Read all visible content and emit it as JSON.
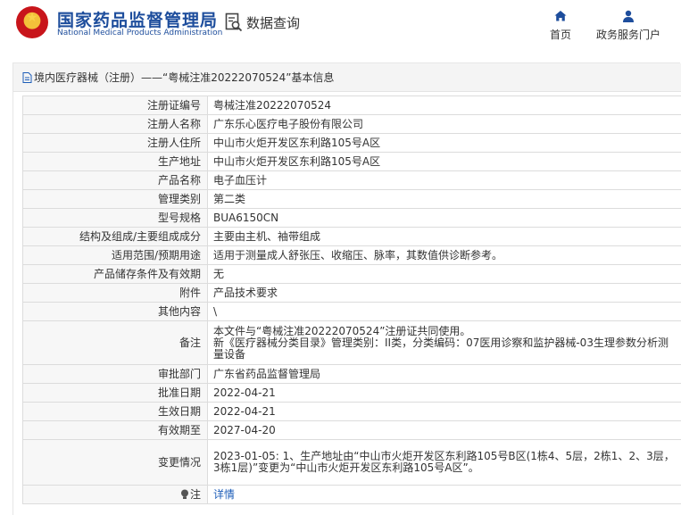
{
  "header": {
    "site_name": "国家药品监督管理局",
    "site_name_en": "National Medical Products Administration",
    "search_label": "数据查询",
    "nav": [
      {
        "label": "首页",
        "icon": "home-icon"
      },
      {
        "label": "政务服务门户",
        "icon": "user-icon"
      }
    ]
  },
  "breadcrumb": {
    "text": "境内医疗器械（注册）——“粤械注准20222070524”基本信息"
  },
  "record": {
    "rows": [
      {
        "label": "注册证编号",
        "value": "粤械注准20222070524"
      },
      {
        "label": "注册人名称",
        "value": "广东乐心医疗电子股份有限公司"
      },
      {
        "label": "注册人住所",
        "value": "中山市火炬开发区东利路105号A区"
      },
      {
        "label": "生产地址",
        "value": "中山市火炬开发区东利路105号A区"
      },
      {
        "label": "产品名称",
        "value": "电子血压计"
      },
      {
        "label": "管理类别",
        "value": "第二类"
      },
      {
        "label": "型号规格",
        "value": "BUA6150CN"
      },
      {
        "label": "结构及组成/主要组成成分",
        "value": "主要由主机、袖带组成"
      },
      {
        "label": "适用范围/预期用途",
        "value": "适用于测量成人舒张压、收缩压、脉率，其数值供诊断参考。"
      },
      {
        "label": "产品储存条件及有效期",
        "value": "无"
      },
      {
        "label": "附件",
        "value": "产品技术要求"
      },
      {
        "label": "其他内容",
        "value": "\\"
      },
      {
        "label": "备注",
        "value": "本文件与“粤械注准20222070524”注册证共同使用。\n新《医疗器械分类目录》管理类别：II类，分类编码：07医用诊察和监护器械-03生理参数分析测量设备"
      },
      {
        "label": "审批部门",
        "value": "广东省药品监督管理局"
      },
      {
        "label": "批准日期",
        "value": "2022-04-21"
      },
      {
        "label": "生效日期",
        "value": "2022-04-21"
      },
      {
        "label": "有效期至",
        "value": "2027-04-20"
      },
      {
        "label": "变更情况",
        "value": "2023-01-05: 1、生产地址由“中山市火炬开发区东利路105号B区(1栋4、5层，2栋1、2、3层，3栋1层)”变更为“中山市火炬开发区东利路105号A区”。"
      }
    ],
    "note_label": "注",
    "note_link": "详情"
  }
}
